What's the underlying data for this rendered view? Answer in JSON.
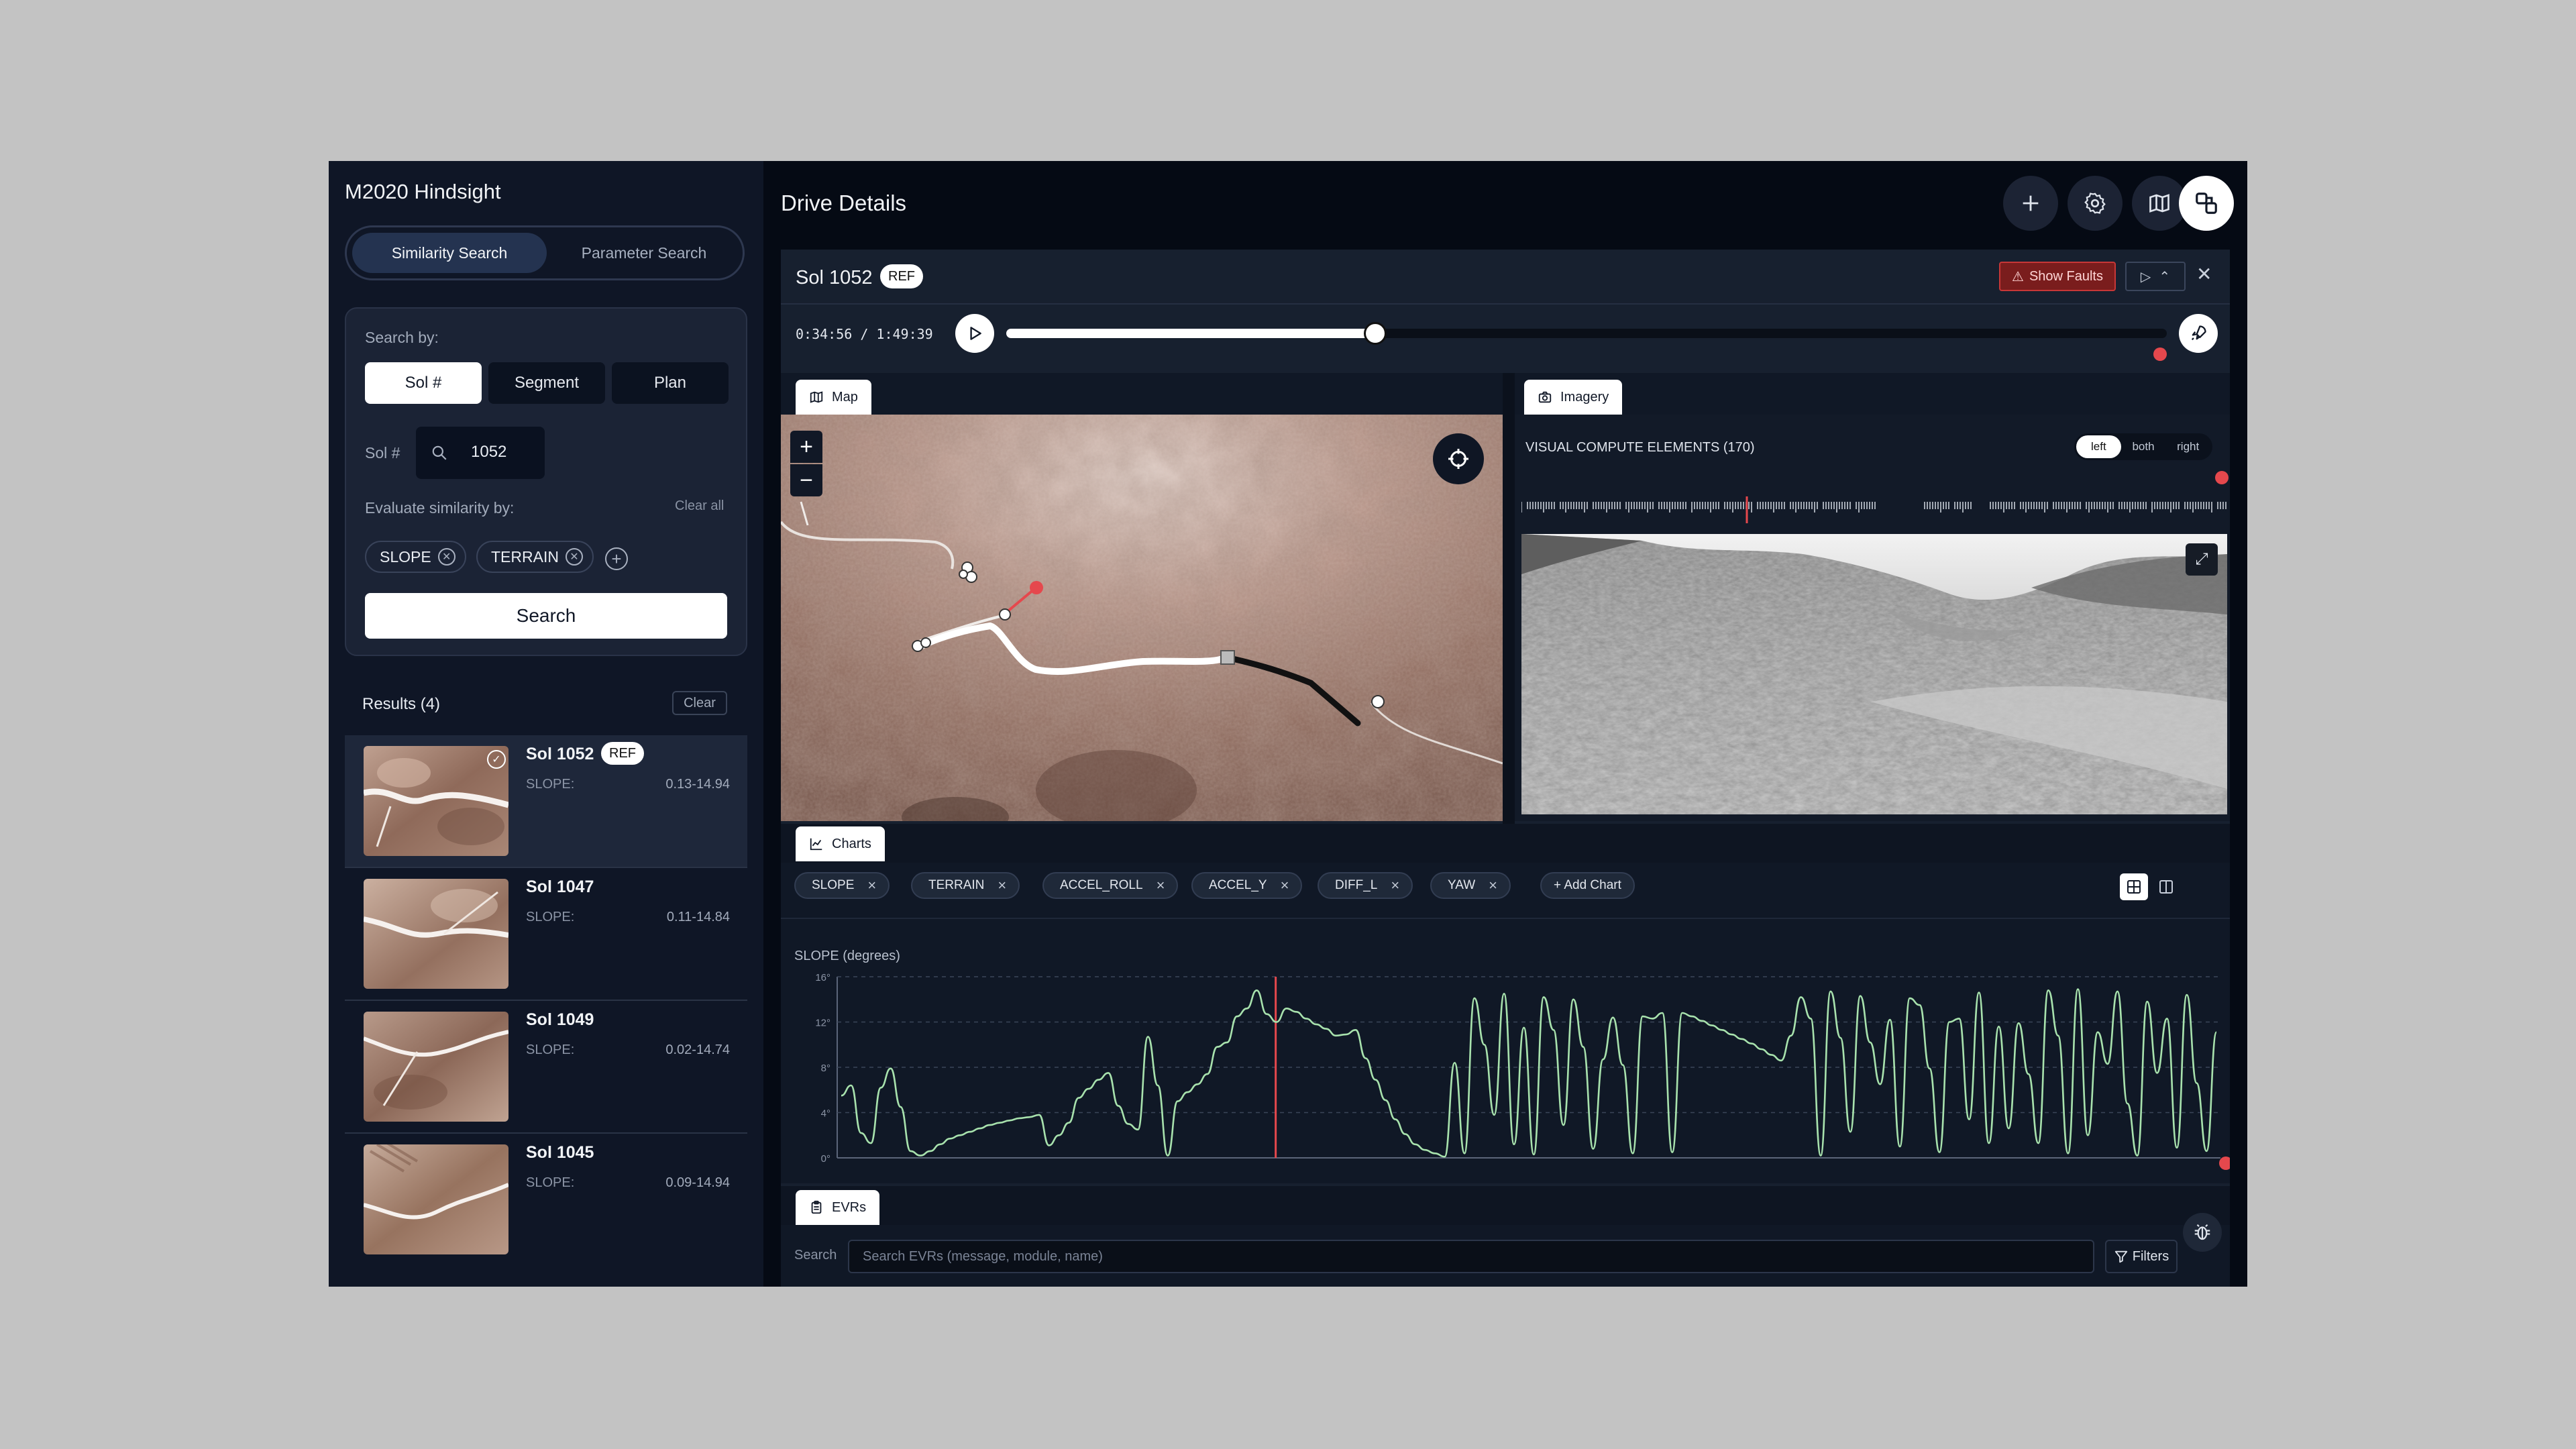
{
  "app": {
    "title": "M2020 Hindsight"
  },
  "sidebar": {
    "modes": [
      "Similarity Search",
      "Parameter Search"
    ],
    "search_by_label": "Search by:",
    "search_by": [
      "Sol #",
      "Segment",
      "Plan"
    ],
    "sol_label": "Sol #",
    "sol_value": "1052",
    "evaluate_label": "Evaluate similarity by:",
    "clear_all": "Clear all",
    "chips": [
      "SLOPE",
      "TERRAIN"
    ],
    "search_button": "Search",
    "results_title": "Results (4)",
    "results_clear": "Clear",
    "results": [
      {
        "name": "Sol 1052",
        "badge": "REF",
        "metric": "SLOPE:",
        "range": "0.13-14.94",
        "selected": true
      },
      {
        "name": "Sol 1047",
        "metric": "SLOPE:",
        "range": "0.11-14.84"
      },
      {
        "name": "Sol 1049",
        "metric": "SLOPE:",
        "range": "0.02-14.74"
      },
      {
        "name": "Sol 1045",
        "metric": "SLOPE:",
        "range": "0.09-14.94"
      }
    ]
  },
  "header": {
    "title": "Drive Details",
    "icons": [
      "plus-icon",
      "gear-icon",
      "map-icon",
      "compare-icon"
    ]
  },
  "drive": {
    "sol": "Sol 1052",
    "badge": "REF",
    "show_faults": "Show Faults",
    "timeline": {
      "current": "0:34:56",
      "total": "1:49:39",
      "time_label": "0:34:56 / 1:49:39",
      "progress": 0.318
    }
  },
  "map": {
    "tab": "Map",
    "zoom_in": "+",
    "zoom_out": "−"
  },
  "imagery": {
    "tab": "Imagery",
    "title": "VISUAL COMPUTE ELEMENTS (170)",
    "views": [
      "left",
      "both",
      "right"
    ],
    "selected_view": "left"
  },
  "charts": {
    "tab": "Charts",
    "chips": [
      "SLOPE",
      "TERRAIN",
      "ACCEL_ROLL",
      "ACCEL_Y",
      "DIFF_L",
      "YAW"
    ],
    "add_chart": "+ Add Chart",
    "title": "SLOPE (degrees)"
  },
  "chart_data": {
    "type": "line",
    "title": "SLOPE (degrees)",
    "ylim": [
      0,
      16
    ],
    "y_ticks": [
      "0°",
      "4°",
      "8°",
      "12°",
      "16°"
    ],
    "grid": true,
    "marker_x": 0.317,
    "series": [
      {
        "color": "#a8e2ad",
        "values": [
          5.5,
          6.4,
          2.2,
          1.3,
          6.2,
          7.9,
          4.5,
          0.6,
          0.2,
          0.6,
          1.2,
          1.7,
          2.0,
          2.3,
          2.6,
          2.9,
          3.1,
          3.3,
          3.5,
          3.6,
          3.8,
          1.1,
          2.0,
          3.1,
          5.3,
          6.1,
          6.9,
          7.5,
          4.6,
          3.0,
          2.5,
          10.7,
          6.4,
          0.2,
          5.0,
          5.8,
          6.5,
          7.4,
          9.8,
          10.2,
          12.5,
          13.2,
          14.8,
          12.7,
          12.0,
          13.2,
          12.9,
          12.3,
          11.8,
          11.4,
          10.8,
          10.9,
          11.3,
          8.8,
          6.9,
          5.1,
          3.4,
          2.1,
          1.2,
          0.7,
          0.4,
          0.1,
          8.4,
          0.4,
          14.1,
          10.0,
          3.8,
          14.5,
          1.2,
          11.5,
          0.3,
          14.2,
          11.3,
          2.9,
          14.0,
          9.8,
          0.8,
          8.7,
          12.4,
          8.2,
          0.4,
          12.5,
          12.3,
          12.8,
          0.5,
          12.8,
          12.5,
          12.1,
          11.7,
          11.3,
          10.9,
          10.5,
          10.1,
          9.6,
          9.1,
          8.6,
          10.8,
          14.2,
          12.3,
          0.2,
          14.7,
          10.6,
          2.3,
          14.3,
          10.2,
          6.5,
          12.2,
          1.0,
          14.1,
          13.5,
          7.9,
          0.5,
          12.0,
          12.3,
          3.4,
          14.6,
          1.3,
          11.6,
          2.6,
          11.9,
          7.4,
          1.3,
          14.8,
          10.8,
          0.4,
          14.9,
          2.0,
          11.1,
          8.3,
          14.7,
          4.8,
          0.2,
          13.8,
          7.5,
          12.3,
          0.9,
          14.4,
          6.6,
          0.6,
          11.1
        ]
      }
    ]
  },
  "evrs": {
    "tab": "EVRs",
    "search_label": "Search",
    "placeholder": "Search EVRs (message, module, name)",
    "filters": "Filters"
  }
}
